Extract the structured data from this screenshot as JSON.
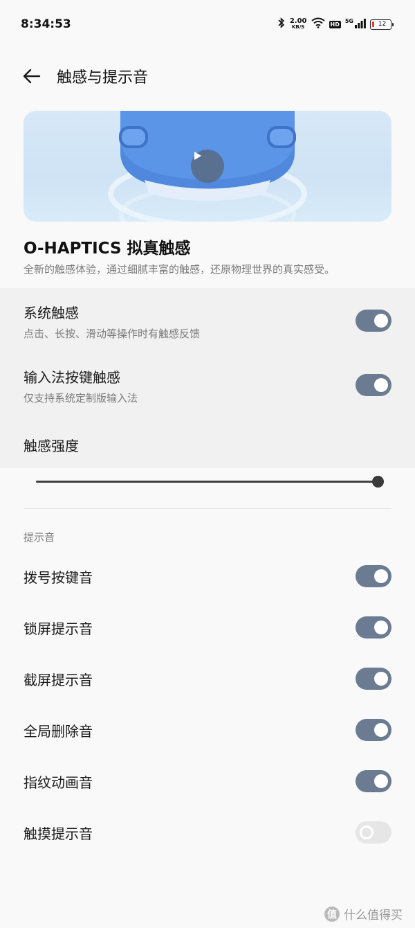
{
  "status_bar": {
    "time": "8:34:53",
    "net_speed_value": "2.00",
    "net_speed_unit": "KB/S",
    "hd_badge": "HD",
    "network_type": "5G",
    "battery_level": "12",
    "icons": [
      "bluetooth-icon",
      "wifi-icon",
      "signal-icon",
      "battery-icon"
    ]
  },
  "header": {
    "title": "触感与提示音"
  },
  "feature": {
    "title": "O-HAPTICS 拟真触感",
    "description": "全新的触感体验，通过细腻丰富的触感，还原物理世界的真实感受。"
  },
  "haptics": {
    "system": {
      "title": "系统触感",
      "subtitle": "点击、长按、滑动等操作时有触感反馈",
      "on": true
    },
    "keyboard": {
      "title": "输入法按键触感",
      "subtitle": "仅支持系统定制版输入法",
      "on": true
    },
    "intensity": {
      "title": "触感强度",
      "level": 1.0
    }
  },
  "sounds": {
    "section_label": "提示音",
    "items": [
      {
        "label": "拨号按键音",
        "on": true
      },
      {
        "label": "锁屏提示音",
        "on": true
      },
      {
        "label": "截屏提示音",
        "on": true
      },
      {
        "label": "全局删除音",
        "on": true
      },
      {
        "label": "指纹动画音",
        "on": true
      },
      {
        "label": "触摸提示音",
        "on": false
      }
    ]
  },
  "watermark": {
    "logo": "值",
    "text": "什么值得买"
  },
  "colors": {
    "toggle_on": "#6b7b91",
    "toggle_off": "#e6e6e6",
    "battery_low": "#e53935"
  }
}
